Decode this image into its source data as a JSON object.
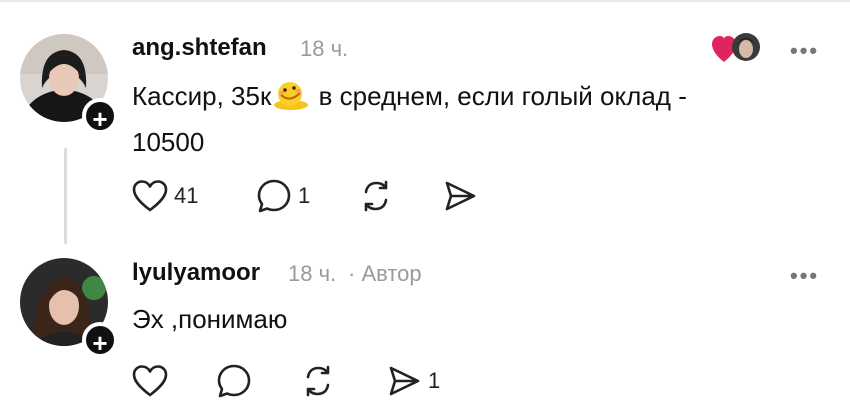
{
  "posts": [
    {
      "username": "ang.shtefan",
      "time": "18 ч.",
      "author_tag": "",
      "text_before_emoji": "Кассир, 35к",
      "emoji": "melting-face",
      "text_after_emoji": " в среднем, если голый оклад -",
      "text_line2": "10500",
      "likes": "41",
      "replies": "1",
      "reposts": "",
      "shares": "",
      "more_label": "•••"
    },
    {
      "username": "lyulyamoor",
      "time": "18 ч.",
      "author_tag": "· Автор",
      "text": "Эх ,понимаю",
      "likes": "",
      "replies": "",
      "reposts": "",
      "shares": "1",
      "more_label": "•••"
    }
  ],
  "follow_badge": "+",
  "colors": {
    "heart_red": "#e0245e",
    "muted": "#9a9a9a",
    "text": "#111111"
  }
}
